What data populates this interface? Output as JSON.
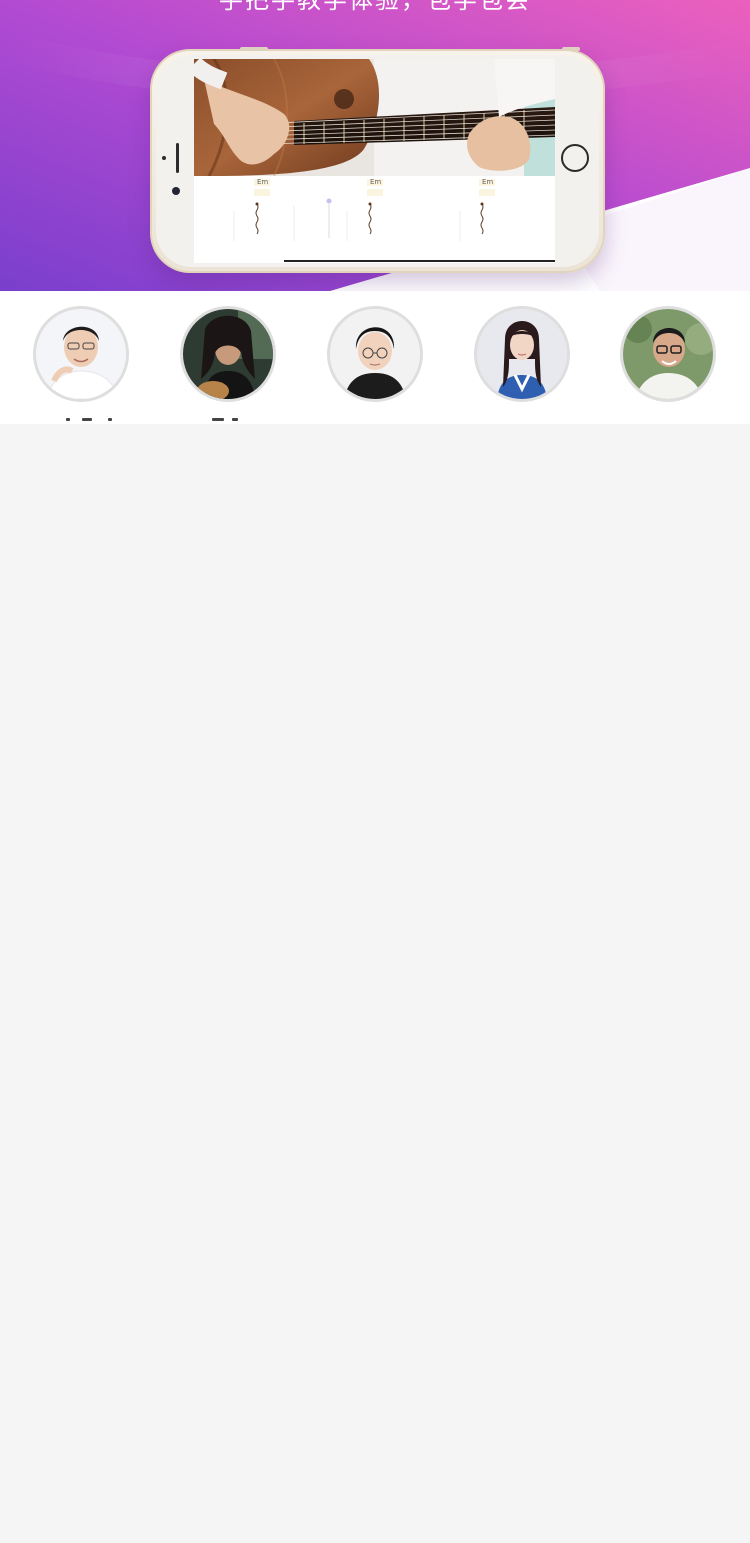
{
  "hero": {
    "tagline": "手把手教学体验，包学包会",
    "gradient": {
      "start": "#7b3fcf",
      "mid": "#b54bd3",
      "end": "#ea5fc1"
    }
  },
  "phone": {
    "body_color": "#f3eee5",
    "screen": {
      "chords": [
        "Em",
        "Em",
        "Em"
      ],
      "strum_icon": "strum-wave-icon"
    }
  },
  "teachers": {
    "avatars": [
      {
        "name": "teacher-1",
        "icon": "avatar-photo"
      },
      {
        "name": "teacher-2",
        "icon": "avatar-photo"
      },
      {
        "name": "teacher-3",
        "icon": "avatar-photo"
      },
      {
        "name": "teacher-4",
        "icon": "avatar-photo"
      },
      {
        "name": "teacher-5",
        "icon": "avatar-photo"
      }
    ]
  },
  "colors": {
    "page_background": "#f5f5f5",
    "avatar_border": "#dedede"
  }
}
